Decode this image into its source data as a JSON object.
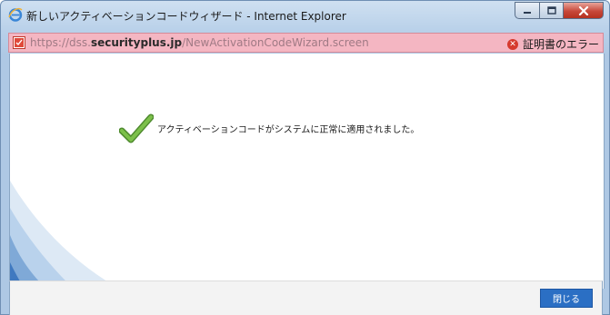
{
  "window": {
    "title": "新しいアクティベーションコードウィザード - Internet Explorer",
    "controls": {
      "minimize": "minimize-icon",
      "maximize": "maximize-icon",
      "close": "close-icon"
    }
  },
  "address_bar": {
    "url_prefix": "https://dss.",
    "url_host": "securityplus.jp",
    "url_path": "/NewActivationCodeWizard.screen",
    "cert_error_label": "証明書のエラー",
    "background_color": "#f4b6c2"
  },
  "content": {
    "success_icon": "checkmark-icon",
    "message": "アクティベーションコードがシステムに正常に適用されました。"
  },
  "footer": {
    "close_button_label": "閉じる",
    "accent_color": "#2b6fc4"
  }
}
